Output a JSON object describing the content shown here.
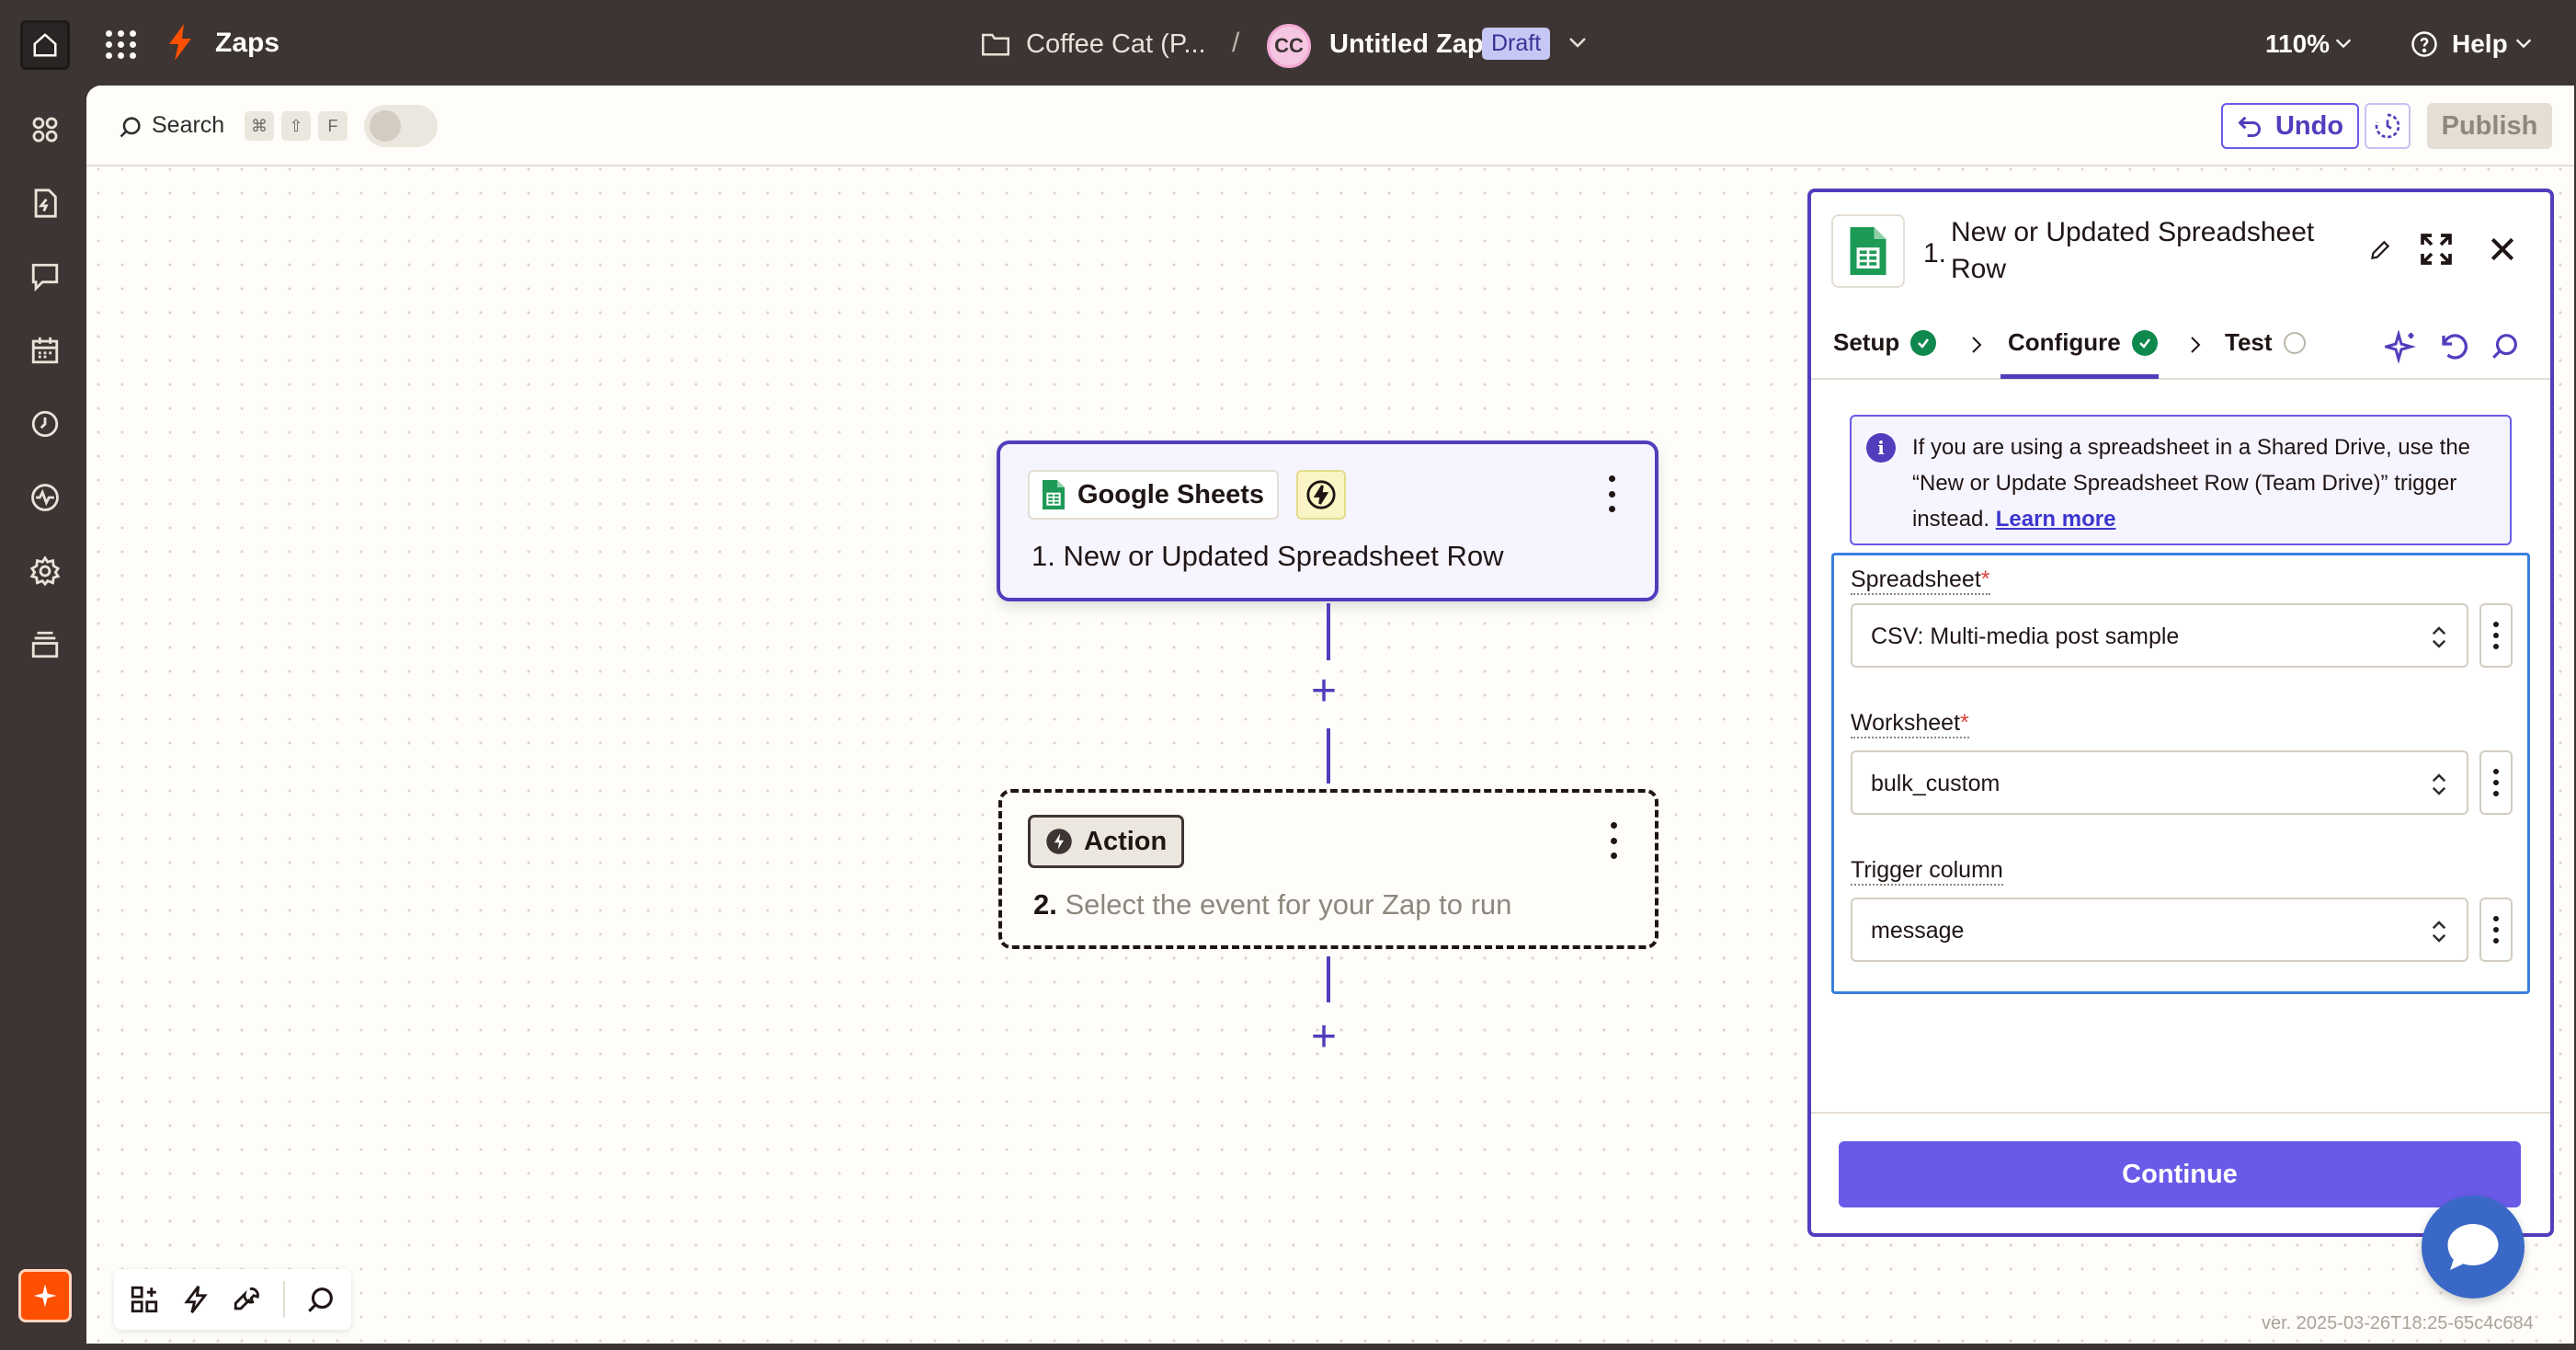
{
  "topbar": {
    "app_title": "Zaps",
    "folder_name": "Coffee Cat (P...",
    "separator": "/",
    "avatar_initials": "CC",
    "zap_title": "Untitled Zap",
    "status_badge": "Draft",
    "zoom": "110%",
    "help_label": "Help"
  },
  "toolbar": {
    "search_label": "Search",
    "shortcut_keys": [
      "⌘",
      "⇧",
      "F"
    ],
    "undo_label": "Undo",
    "publish_label": "Publish"
  },
  "sidebar": {
    "icons": [
      "apps-icon",
      "zap-file-icon",
      "chat-icon",
      "calendar-icon",
      "history-icon",
      "activity-icon",
      "settings-icon",
      "archive-icon"
    ]
  },
  "canvas": {
    "trigger": {
      "app_name": "Google Sheets",
      "step_text": "1. New or Updated Spreadsheet Row"
    },
    "action": {
      "chip_label": "Action",
      "step_number": "2.",
      "step_text": "Select the event for your Zap to run"
    },
    "version": "ver. 2025-03-26T18:25-65c4c684"
  },
  "panel": {
    "step_number": "1.",
    "title": "New or Updated Spreadsheet Row",
    "tabs": [
      {
        "label": "Setup",
        "status": "complete"
      },
      {
        "label": "Configure",
        "status": "complete"
      },
      {
        "label": "Test",
        "status": "pending"
      }
    ],
    "info_text": "If you are using a spreadsheet in a Shared Drive, use the “New or Update Spreadsheet Row (Team Drive)” trigger instead.",
    "info_link": "Learn more",
    "fields": [
      {
        "label": "Spreadsheet",
        "required": "*",
        "value": "CSV: Multi-media post sample"
      },
      {
        "label": "Worksheet",
        "required": "*",
        "value": "bulk_custom"
      },
      {
        "label": "Trigger column",
        "required": "",
        "value": "message"
      }
    ],
    "continue_label": "Continue"
  },
  "colors": {
    "brand_orange": "#ff4f00",
    "accent_purple": "#695be8",
    "dark_purple": "#503ebd",
    "success_green": "#0f884e",
    "sheets_green": "#1e9a57"
  }
}
